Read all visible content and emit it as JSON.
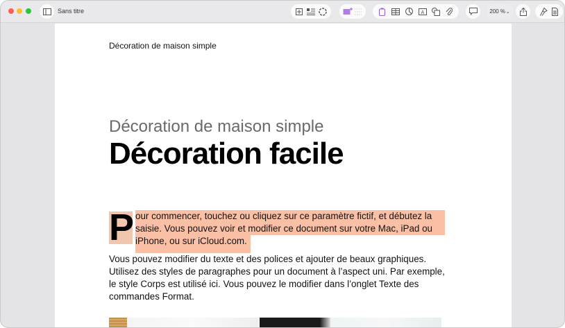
{
  "window": {
    "title": "Sans titre"
  },
  "toolbar": {
    "groups": [
      {
        "items": [
          "insert-page-icon",
          "text-list-icon",
          "format-icon"
        ]
      },
      {
        "items": [
          "media-icon",
          "grid-icon"
        ]
      },
      {
        "items": [
          "text-box-icon",
          "table-icon",
          "chart-icon",
          "text-icon",
          "shape-icon",
          "attachment-icon"
        ]
      },
      {
        "items": [
          "comment-icon"
        ]
      }
    ],
    "zoom_label": "200 %",
    "accent": "#9b59e0"
  },
  "document": {
    "header": "Décoration de maison simple",
    "subtitle": "Décoration de maison simple",
    "title": "Décoration facile",
    "drop_cap": "P",
    "para1_lines": [
      "our commencer, touchez ou cliquez sur ce paramètre fictif, et débutez la",
      "saisie. Vous pouvez voir et modifier ce document sur votre Mac, iPad ou",
      "iPhone, ou sur iCloud.com."
    ],
    "para2": "Vous pouvez modifier du texte et des polices et ajouter de beaux graphiques. Utilisez des styles de paragraphes pour un document à l’aspect uni. Par exemple, le style Corps est utilisé ici. Vous pouvez le modifier dans l’onglet Texte des commandes Format.",
    "highlight_color": "#f9c0a6"
  }
}
